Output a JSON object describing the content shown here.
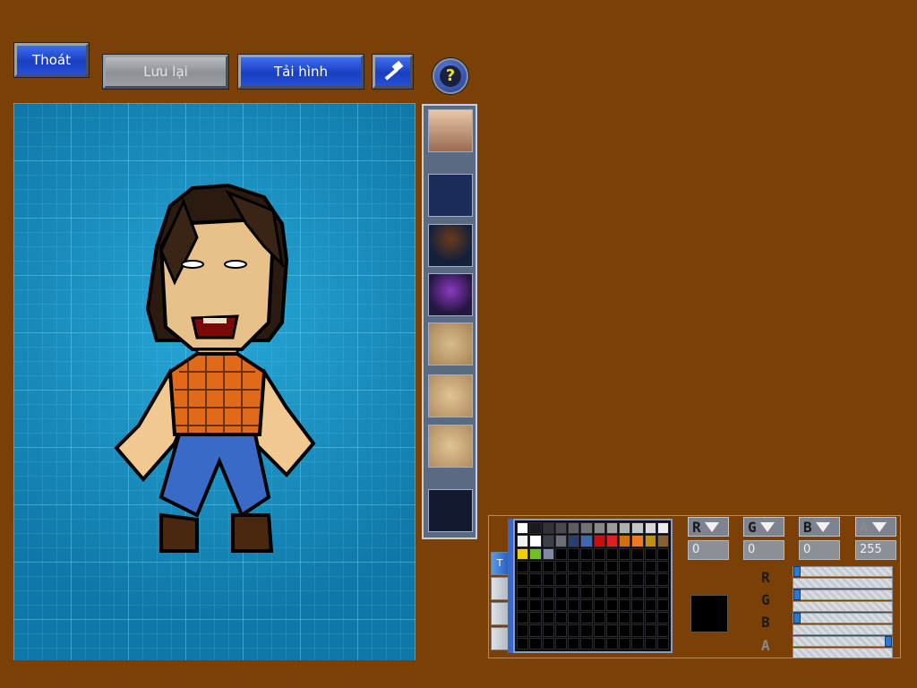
{
  "toolbar": {
    "exit_label": "Thoát",
    "save_label": "Lưu lại",
    "reload_label": "Tải hình",
    "tool_icon": "hammer-icon",
    "help_icon": "help-question-icon",
    "help_glyph": "?"
  },
  "parts_panel": {
    "items": [
      {
        "name": "face-portrait-thumb"
      },
      {
        "name": "empty-slot"
      },
      {
        "name": "hair-thumb"
      },
      {
        "name": "purple-hair-thumb"
      },
      {
        "name": "eyes-thumb"
      },
      {
        "name": "mouth-thumb"
      },
      {
        "name": "face-thumb"
      },
      {
        "name": "empty-slot"
      }
    ]
  },
  "color_editor": {
    "channels": [
      {
        "key": "R",
        "value": "0"
      },
      {
        "key": "G",
        "value": "0"
      },
      {
        "key": "B",
        "value": "0"
      },
      {
        "key": "A",
        "value": "255"
      }
    ],
    "sliders": [
      {
        "key": "R",
        "level": 0
      },
      {
        "key": "G",
        "level": 0
      },
      {
        "key": "B",
        "level": 0
      },
      {
        "key": "A",
        "level": 1
      }
    ],
    "selected_color": "#000000",
    "tab_label": "T",
    "palette_row1": [
      "#ffffff",
      "#1a1a1a",
      "#333333",
      "#4a4a4a",
      "#5e5e5e",
      "#727272",
      "#878787",
      "#9c9c9c",
      "#b0b0b0",
      "#c4c4c4",
      "#d8d8d8",
      "#ececec"
    ],
    "palette_row2": [
      "#f0f0f0",
      "#ffffff",
      "#3a3f48",
      "#6a6e76",
      "#2a3f6e",
      "#3f68b0",
      "#c81010",
      "#e02020",
      "#d07010",
      "#f07820",
      "#c09010",
      "#8a6030"
    ],
    "palette_row3": [
      "#f0d000",
      "#70c020",
      "#8088a8"
    ]
  },
  "colors": {
    "background": "#7a4006",
    "button_blue": "#1a3ec0",
    "canvas_blue": "#1a8fc0"
  }
}
